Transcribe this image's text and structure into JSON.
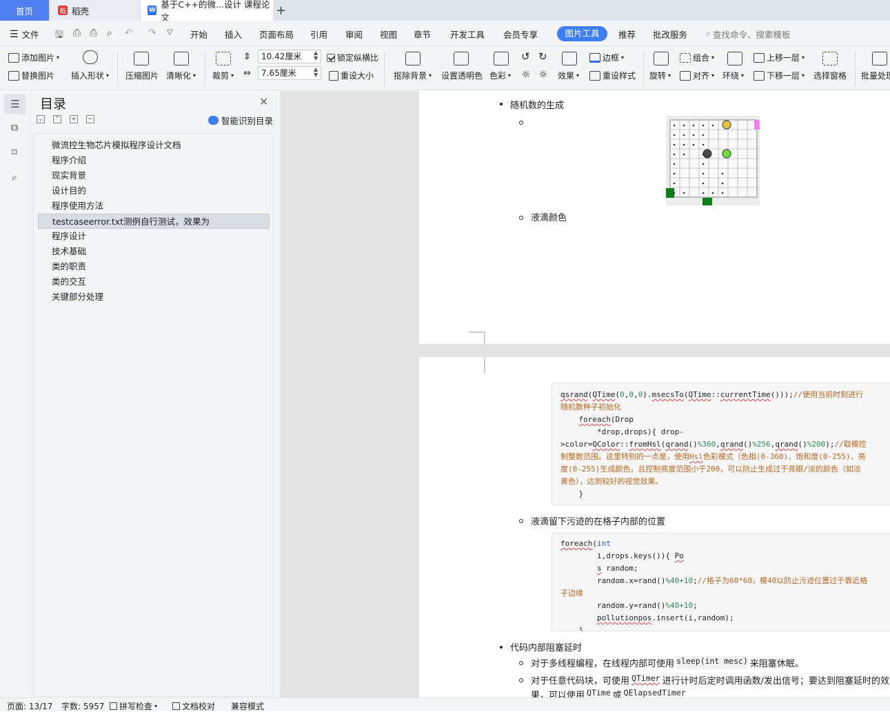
{
  "tabs": {
    "home": "首页",
    "daoke": "稻壳",
    "doc": "基于C++的微...设计 课程论文",
    "add": "+"
  },
  "menu": {
    "file": "文件",
    "items": [
      "开始",
      "插入",
      "页面布局",
      "引用",
      "审阅",
      "视图",
      "章节",
      "开发工具",
      "会员专享"
    ],
    "active": "图片工具",
    "after": [
      "推荐",
      "批改服务"
    ],
    "search_placeholder": "查找命令、搜索模板"
  },
  "ribbon": {
    "add_picture": "添加图片",
    "replace_picture": "替换图片",
    "insert_shape": "插入形状",
    "compress": "压缩图片",
    "sharpen": "清晰化",
    "crop": "裁剪",
    "width": "10.42厘米",
    "height": "7.65厘米",
    "lock_ratio": "锁定纵横比",
    "reset_size": "重设大小",
    "remove_bg": "抠除背景",
    "set_transparent": "设置透明色",
    "color": "色彩",
    "effect": "效果",
    "reset_style": "重设样式",
    "border": "边框",
    "rotate": "旋转",
    "group": "组合",
    "align": "对齐",
    "wrap": "环绕",
    "bring_forward": "上移一层",
    "send_backward": "下移一层",
    "selection_pane": "选择窗格",
    "batch": "批量处理"
  },
  "toc": {
    "title": "目录",
    "smart": "智能识别目录",
    "items": [
      "微流控生物芯片模拟程序设计文档",
      "程序介绍",
      "现实背景",
      "设计目的",
      "程序使用方法",
      "testcaseerror.txt测例自行测试，效果为",
      "程序设计",
      "技术基础",
      "类的职责",
      "类的交互",
      "关键部分处理"
    ],
    "selected_index": 5
  },
  "doc": {
    "bullet_random": "随机数的生成",
    "bullet_color": "液滴颜色",
    "code1": [
      {
        "parts": [
          [
            "qsrand",
            "ul"
          ],
          [
            "(",
            ""
          ],
          [
            "QTime",
            "ul"
          ],
          [
            "(",
            ""
          ],
          [
            "0",
            "cg"
          ],
          [
            ",",
            ""
          ],
          [
            "0",
            "cg"
          ],
          [
            ",",
            ""
          ],
          [
            "0",
            "cg"
          ],
          [
            ").",
            ""
          ],
          [
            "msecsTo",
            "ul"
          ],
          [
            "(",
            ""
          ],
          [
            "QTime",
            "ul"
          ],
          [
            "::",
            ""
          ],
          [
            "currentTime",
            "ul"
          ],
          [
            "()));",
            ""
          ],
          [
            "//使用当前时刻进行",
            "cm"
          ]
        ]
      },
      {
        "parts": [
          [
            "随机数种子初始化",
            "cm"
          ]
        ]
      },
      {
        "parts": [
          [
            "    ",
            ""
          ],
          [
            "foreach",
            "ul"
          ],
          [
            "(Drop",
            ""
          ]
        ]
      },
      {
        "parts": [
          [
            "        *drop,drops){ drop-",
            ""
          ]
        ]
      },
      {
        "parts": [
          [
            ">color=",
            ""
          ],
          [
            "QColor",
            "ul"
          ],
          [
            "::",
            ""
          ],
          [
            "fromHsl",
            "ul"
          ],
          [
            "(",
            ""
          ],
          [
            "qrand",
            "ul"
          ],
          [
            "()",
            ""
          ],
          [
            "%360",
            "cg"
          ],
          [
            ",",
            ""
          ],
          [
            "qrand",
            "ul"
          ],
          [
            "()",
            ""
          ],
          [
            "%256",
            "cg"
          ],
          [
            ",",
            ""
          ],
          [
            "qrand",
            "ul"
          ],
          [
            "()",
            ""
          ],
          [
            "%200",
            "cg"
          ],
          [
            ");",
            ""
          ],
          [
            "//取模控",
            "cm"
          ]
        ]
      },
      {
        "parts": [
          [
            "制整数范围。这里特别的一点是，使用",
            "cm"
          ],
          [
            "Hsl",
            "ul cm"
          ],
          [
            "色彩模式（色相(0-360)、饱和度(0-255)、亮",
            "cm"
          ]
        ]
      },
      {
        "parts": [
          [
            "度(0-255)生成颜色，且控制亮度范围小于200，可以防止生成过于亮眼/淡的颜色（如淡",
            "cm"
          ]
        ]
      },
      {
        "parts": [
          [
            "黄色），达到较好的视觉效果。",
            "cm"
          ]
        ]
      },
      {
        "parts": [
          [
            "    }",
            ""
          ]
        ]
      }
    ],
    "bullet_pollution": "液滴留下污迹的在格子内部的位置",
    "code2": [
      {
        "parts": [
          [
            "foreach",
            "ul"
          ],
          [
            "(",
            ""
          ],
          [
            "int",
            "cb"
          ]
        ]
      },
      {
        "parts": [
          [
            "        i,drops.keys()){ ",
            ""
          ],
          [
            "Po",
            "ul"
          ]
        ]
      },
      {
        "parts": [
          [
            "        ",
            ""
          ],
          [
            "s",
            "ul"
          ],
          [
            " random;",
            ""
          ]
        ]
      },
      {
        "parts": [
          [
            "        random.x=rand()",
            ""
          ],
          [
            "%40+10",
            "cg"
          ],
          [
            ";",
            ""
          ],
          [
            "//格子为60*60，模40以防止污迹位置过于靠近格",
            "cm"
          ]
        ]
      },
      {
        "parts": [
          [
            "子边缘",
            "cm"
          ]
        ]
      },
      {
        "parts": [
          [
            "        random.y=rand()",
            ""
          ],
          [
            "%40+10",
            "cg"
          ],
          [
            ";",
            ""
          ]
        ]
      },
      {
        "parts": [
          [
            "        ",
            ""
          ],
          [
            "pollutionpos",
            "ul"
          ],
          [
            ".insert(i,random);",
            ""
          ]
        ]
      },
      {
        "parts": [
          [
            "    }",
            ""
          ]
        ]
      }
    ],
    "bullet_delay": "代码内部阻塞延时",
    "sub1_a": "对于多线程编程，在线程内部可使用",
    "sub1_code": "sleep(int mesc)",
    "sub1_b": "来阻塞休眠。",
    "sub2_a": "对于任意代码块，可使用",
    "sub2_code": "QTimer",
    "sub2_b": "进行计时后定时调用函数/发出信号；要达到阻塞延时的效",
    "sub2_c": "果，可以使用",
    "sub2_code2": "QTime",
    "sub2_d": "或",
    "sub2_code3": "QElapsedTimer"
  },
  "status": {
    "page": "页面: 13/17",
    "words": "字数: 5957",
    "spell": "拼写检查",
    "proof": "文档校对",
    "compat": "兼容模式"
  },
  "colors": {
    "accent": "#3d7ef7",
    "droplet_yellow": "#e8c23a",
    "droplet_green": "#6fe03a",
    "droplet_dark": "#4a4a4a",
    "port_green": "#0d7f1a",
    "port_pink": "#ee82ee"
  }
}
